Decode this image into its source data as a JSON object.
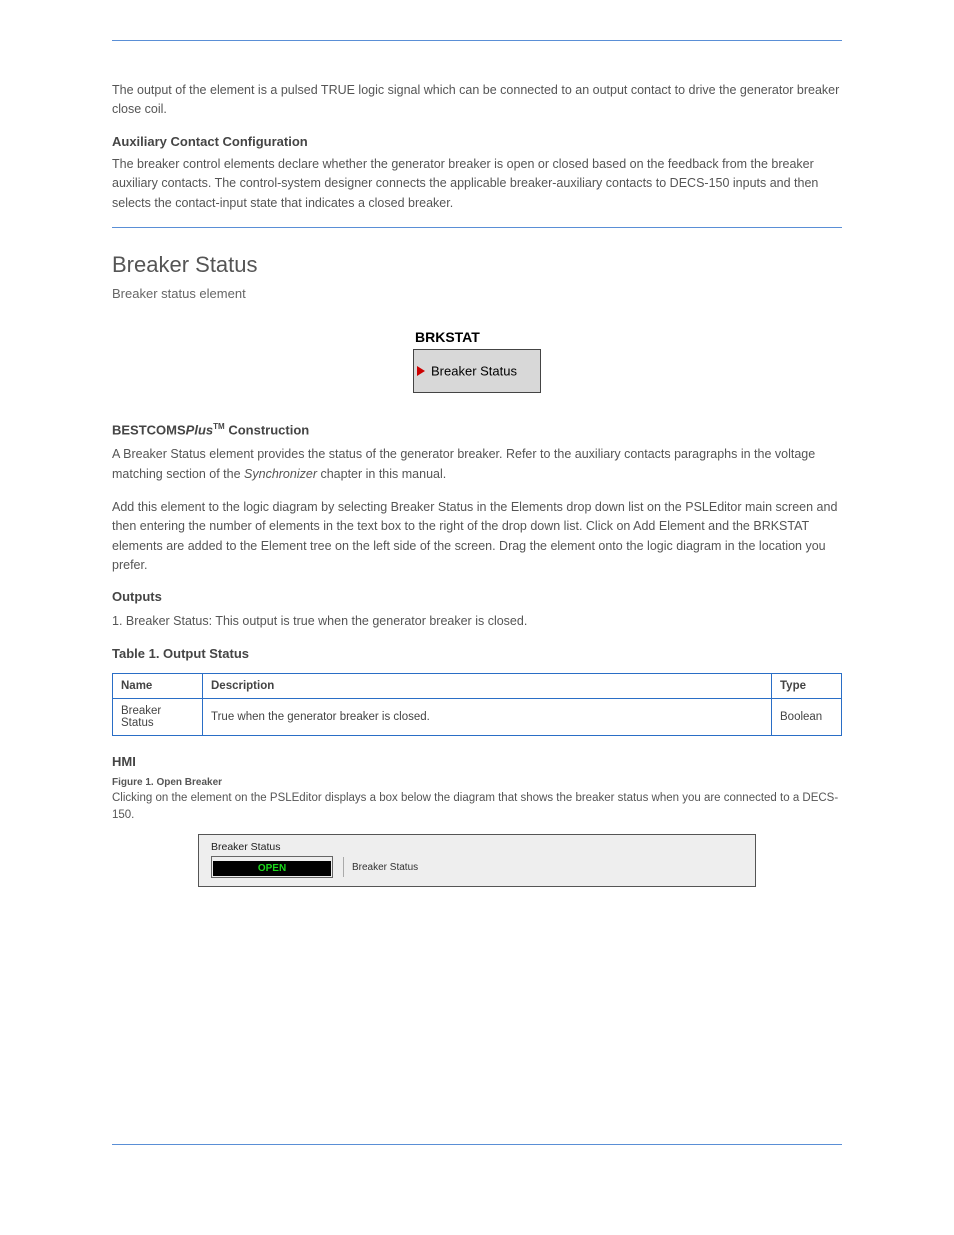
{
  "intro": {
    "p1": "The output of the element is a pulsed TRUE logic signal which can be connected to an output contact to drive the generator breaker close coil.",
    "aux_heading": "Auxiliary Contact Configuration",
    "p2": "The breaker control elements declare whether the generator breaker is open or closed based on the feedback from the breaker auxiliary contacts. The control-system designer connects the applicable breaker-auxiliary contacts to DECS-150 inputs and then selects the contact-input state that indicates a closed breaker."
  },
  "section": {
    "title": "Breaker Status",
    "subline": "Breaker status element",
    "diagram_label": "BRKSTAT",
    "diagram_text": "Breaker Status"
  },
  "bestcoms": {
    "heading_prefix": "BESTCOMS",
    "heading_suffix": " Construction",
    "p1": "A Breaker Status element provides the status of the generator breaker. Refer to the auxiliary contacts paragraphs in the voltage matching section of the ",
    "p1_italic": "Synchronizer",
    "p1_suffix": " chapter in this manual.",
    "p2": "Add this element to the logic diagram by selecting Breaker Status in the Elements drop down list on the PSLEditor main screen and then entering the number of elements in the text box to the right of the drop down list. Click on Add Element and the BRKSTAT elements are added to the Element tree on the left side of the screen. Drag the element onto the logic diagram in the location you prefer."
  },
  "outputs": {
    "heading": "Outputs",
    "num1": "1.",
    "text1": "Breaker Status: This output is true when the generator breaker is closed.",
    "table_heading": "Table 1. Output Status",
    "headers": {
      "name": "Name",
      "desc": "Description",
      "type": "Type"
    },
    "row": {
      "name": "Breaker Status",
      "desc": "True when the generator breaker is closed.",
      "type": "Boolean"
    }
  },
  "hmi": {
    "heading": "HMI",
    "caption": "Figure 1. Open Breaker",
    "desc": "Clicking on the element on the PSLEditor displays a box below the diagram that shows the breaker status when you are connected to a DECS-150.",
    "panel_title": "Breaker Status",
    "value": "OPEN",
    "field_label": "Breaker Status"
  }
}
